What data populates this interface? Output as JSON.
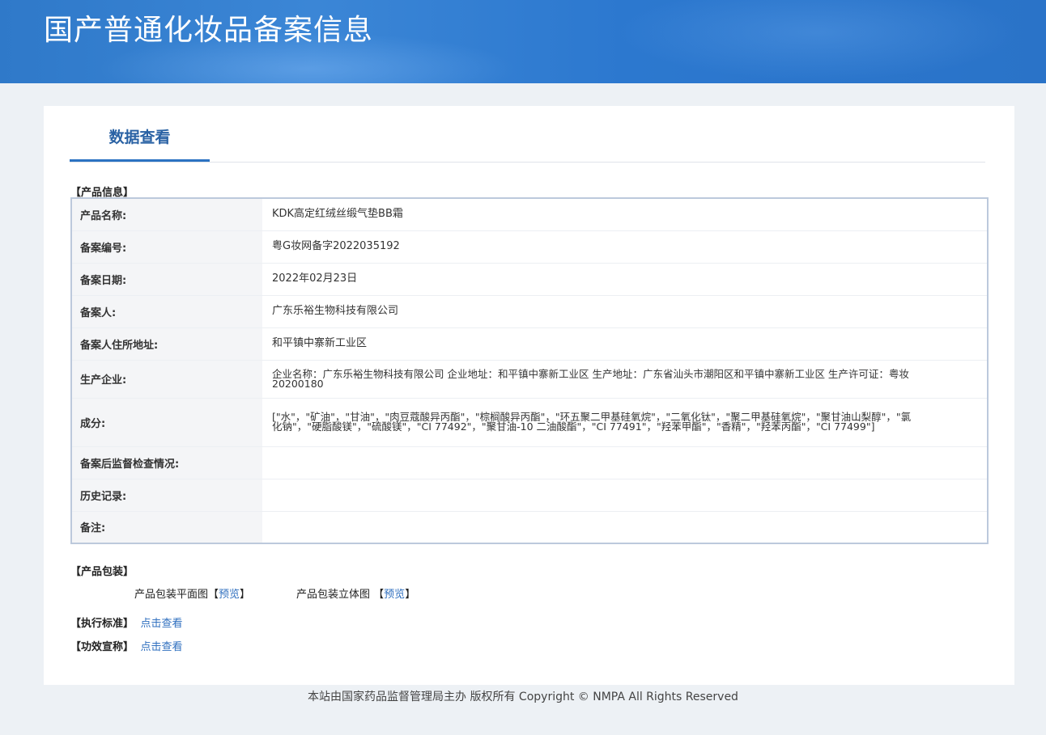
{
  "header": {
    "title": "国产普通化妆品备案信息"
  },
  "tabs": [
    {
      "label": "数据查看"
    }
  ],
  "product_info": {
    "section_label": "【产品信息】",
    "rows": [
      {
        "label": "产品名称:",
        "value": "KDK高定红绒丝缎气垫BB霜"
      },
      {
        "label": "备案编号:",
        "value": "粤G妆网备字2022035192"
      },
      {
        "label": "备案日期:",
        "value": "2022年02月23日"
      },
      {
        "label": "备案人:",
        "value": "广东乐裕生物科技有限公司"
      },
      {
        "label": "备案人住所地址:",
        "value": "和平镇中寨新工业区"
      },
      {
        "label": "生产企业:",
        "value": "企业名称：广东乐裕生物科技有限公司 企业地址：和平镇中寨新工业区 生产地址：广东省汕头市潮阳区和平镇中寨新工业区 生产许可证：粤妆20200180"
      },
      {
        "label": "成分:",
        "value": "[\"水\"，\"矿油\"，\"甘油\"，\"肉豆蔻酸异丙酯\"，\"棕榈酸异丙酯\"，\"环五聚二甲基硅氧烷\"，\"二氧化钛\"，\"聚二甲基硅氧烷\"，\"聚甘油山梨醇\"，\"氯化钠\"，\"硬脂酸镁\"，\"硫酸镁\"，\"CI 77492\"，\"聚甘油-10 二油酸酯\"，\"CI 77491\"，\"羟苯甲酯\"，\"香精\"，\"羟苯丙酯\"，\"CI 77499\"]"
      },
      {
        "label": "备案后监督检查情况:",
        "value": ""
      },
      {
        "label": "历史记录:",
        "value": ""
      },
      {
        "label": "备注:",
        "value": ""
      }
    ]
  },
  "packaging": {
    "section_label": "【产品包装】",
    "flat_label": "产品包装平面图",
    "solid_label": "产品包装立体图",
    "bracket_open": "【",
    "bracket_close": "】",
    "preview_label": "预览"
  },
  "standard": {
    "section_label": "【执行标准】",
    "link_label": "点击查看"
  },
  "efficacy": {
    "section_label": "【功效宣称】",
    "link_label": "点击查看"
  },
  "footer": {
    "text": "本站由国家药品监督管理局主办 版权所有 Copyright © NMPA All Rights Reserved"
  }
}
